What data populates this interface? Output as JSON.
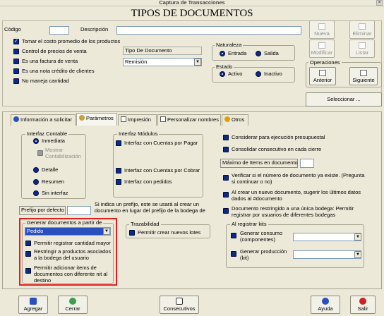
{
  "window": {
    "title": "Captura de Transacciones",
    "close_glyph": "×"
  },
  "heading": "TIPOS DE DOCUMENTOS",
  "header": {
    "codigo_label": "Código",
    "codigo_value": "",
    "descripcion_label": "Descripción",
    "descripcion_value": ""
  },
  "checks": [
    {
      "label": "Tomar el costo promedio de los productos",
      "checked": true
    },
    {
      "label": "Control de precios de venta",
      "checked": false
    },
    {
      "label": "Es una factura de venta",
      "checked": false
    },
    {
      "label": "Es una nota crédito de clientes",
      "checked": false
    },
    {
      "label": "No maneja cantidad",
      "checked": false
    }
  ],
  "tipo_documento": {
    "label": "Tipo De Documento",
    "value": "Remisión"
  },
  "naturaleza": {
    "title": "Naturaleza",
    "options": [
      "Entrada",
      "Salida"
    ]
  },
  "estado": {
    "title": "Estado",
    "options": [
      "Activo",
      "Inactivo"
    ]
  },
  "side_buttons": {
    "nueva": "Nueva",
    "eliminar": "Eliminar",
    "modificar": "Modificar",
    "listar": "Listar",
    "operaciones_title": "Operaciones",
    "anterior": "Anterior",
    "siguiente": "Siguiente",
    "seleccionar": "Seleccionar ..."
  },
  "tabs": [
    {
      "label": "Información a solicitar",
      "icon": "info-icon"
    },
    {
      "label": "Parámetros",
      "icon": "gear-icon",
      "active": true
    },
    {
      "label": "Impresión",
      "icon": "document-icon"
    },
    {
      "label": "Personalizar nombres",
      "icon": "document-icon"
    },
    {
      "label": "Otros",
      "icon": "disc-icon"
    }
  ],
  "interfaz_contable": {
    "title": "Interfaz Contable",
    "options": [
      "Inmediata",
      "Mostrar Contabilización",
      "Detalle",
      "Resumen",
      "Sin interfaz"
    ]
  },
  "interfaz_modulos": {
    "title": "Interfaz Módulos",
    "options": [
      "Interfaz con Cuentas por Pagar",
      "Interfaz con Cuentas por Cobrar",
      "Interfaz con pedidos"
    ]
  },
  "right_options": {
    "presupuestal": "Considerar para ejecución presupuestal",
    "consecutivo": "Consolidar consecutivo en cada cierre",
    "max_items_label": "Máximo de Items en documento",
    "max_items_value": "",
    "verificar": "Verificar si el número de documento ya existe. (Pregunta si continuar o no)",
    "sugerir": "Al crear un nuevo documento, sugerir los últimos datos dados al #documento",
    "restringido": "Documento restringido a una única bodega: Permitir registrar por usuarios de diferentes bodegas"
  },
  "prefijo": {
    "label": "Prefijo por defecto",
    "value": "",
    "help": "Si indica un prefijo, este se usará al crear un documento en lugar del prefijo de la bodega de"
  },
  "generar": {
    "title": "Generar documentos a partir de",
    "value": "Pedido",
    "checks": [
      "Permitir registrar cantidad mayor",
      "Restringir a productos asociados a la bodega del usuario",
      "Permitir adicionar items de documentos con diferente nit al destino"
    ]
  },
  "trazabilidad": {
    "title": "Trazabilidad",
    "option": "Permitir crear nuevos lotes"
  },
  "kits": {
    "title": "Al registrar kits",
    "consumo": "Generar consumo (componentes)",
    "produccion": "Generar producción (kit)"
  },
  "bottom": {
    "agregar": "Agregar",
    "cerrar": "Cerrar",
    "consecutivos": "Consecutivos",
    "ayuda": "Ayuda",
    "salir": "Salir"
  },
  "colors": {
    "accent": "#0a2a88",
    "highlight": "#e02020",
    "selection": "#2a50c0"
  }
}
